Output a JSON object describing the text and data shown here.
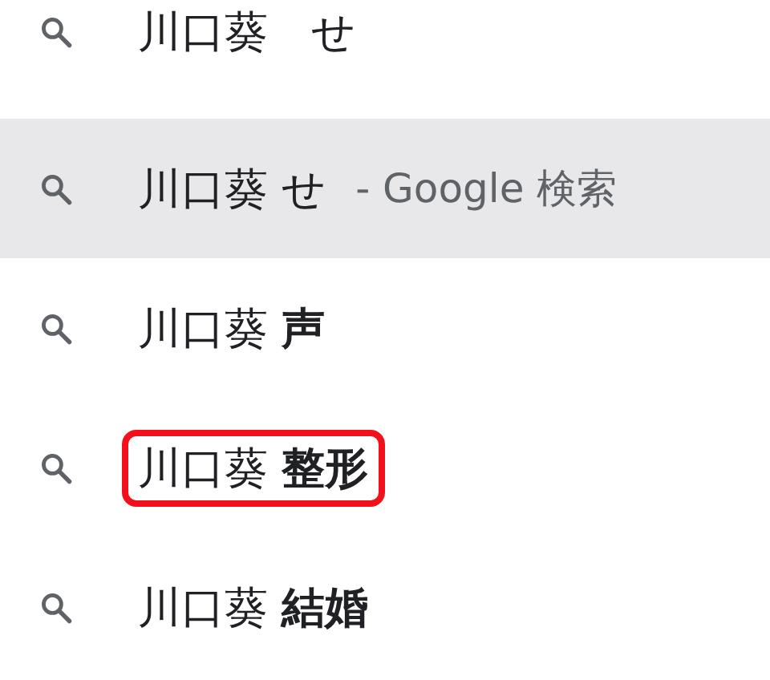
{
  "suggestions": [
    {
      "text": "川口葵　せ",
      "selected": false,
      "outlined": false
    },
    {
      "text": "川口葵 せ",
      "suffix": "- Google 検索",
      "selected": true,
      "outlined": false
    },
    {
      "text": "川口葵 **声**",
      "selected": false,
      "outlined": false
    },
    {
      "text": "川口葵 **整形**",
      "selected": false,
      "outlined": true
    },
    {
      "text": "川口葵 **結婚**",
      "selected": false,
      "outlined": false
    }
  ]
}
